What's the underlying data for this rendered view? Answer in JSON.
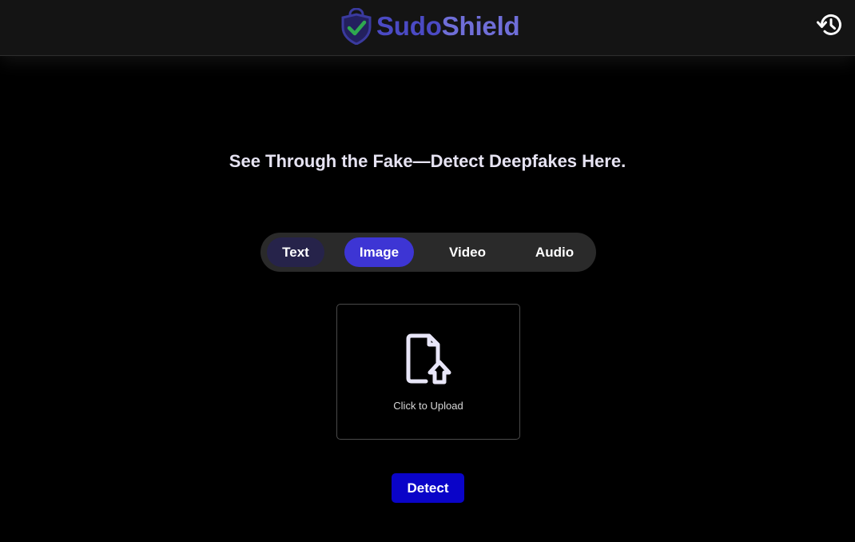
{
  "header": {
    "brand": {
      "name_part_1": "Sudo",
      "name_part_2": "Shield",
      "logo_icon": "shield-check-icon"
    },
    "history_icon": "history-icon"
  },
  "main": {
    "headline": "See Through the Fake—Detect Deepfakes Here.",
    "tabs": [
      {
        "label": "Text",
        "state": "hover"
      },
      {
        "label": "Image",
        "state": "selected"
      },
      {
        "label": "Video",
        "state": "default"
      },
      {
        "label": "Audio",
        "state": "default"
      }
    ],
    "upload": {
      "icon": "file-upload-icon",
      "label": "Click to Upload"
    },
    "detect_button": "Detect"
  },
  "colors": {
    "brand_dark": "#4b4ac4",
    "brand_light": "#6f6ed8",
    "tab_selected": "#3d35d4",
    "tab_hover": "#26234a",
    "detect_button": "#0a04c8",
    "check_green": "#2fa84f"
  }
}
